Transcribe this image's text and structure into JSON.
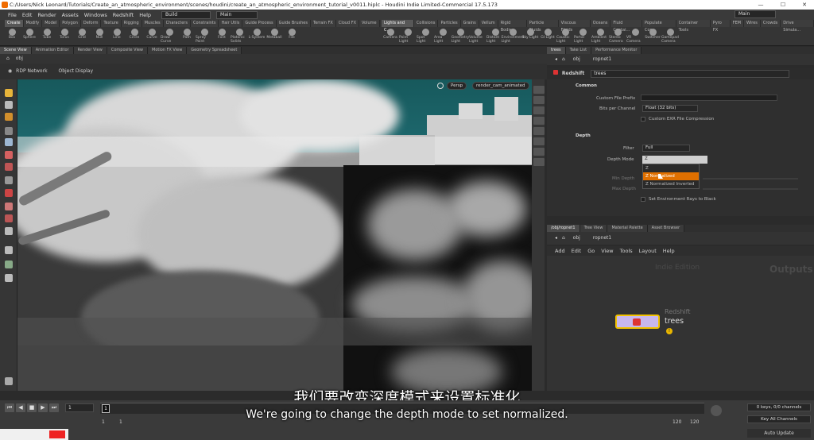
{
  "window": {
    "title": "C:/Users/Nick Leonard/Tutorials/Create_an_atmospheric_environment/scenes/houdini/create_an_atmospheric_environment_tutorial_v0011.hiplc - Houdini Indie Limited-Commercial 17.5.173",
    "minimize": "—",
    "maximize": "☐",
    "close": "✕"
  },
  "menu": {
    "items": [
      "File",
      "Edit",
      "Render",
      "Assets",
      "Windows",
      "Redshift",
      "Help"
    ],
    "desktop": "Build",
    "main": "Main",
    "right_desktop": "Main"
  },
  "shelf": {
    "tabs": [
      "Create",
      "Modify",
      "Model",
      "Polygon",
      "Deform",
      "Texture",
      "Rigging",
      "Muscles",
      "Characters",
      "Constraints",
      "Hair Utils",
      "Guide Process",
      "Guide Brushes",
      "Terrain FX",
      "Cloud FX",
      "Volume"
    ],
    "tools": [
      "Box",
      "Sphere",
      "Tube",
      "Torus",
      "Grid",
      "Null",
      "Line",
      "Circle",
      "Curve",
      "Draw Curve",
      "Path",
      "Spray Paint",
      "Font",
      "Platonic Solids",
      "L-System",
      "Metaball",
      "File"
    ],
    "tabs_right": [
      "Lights and C...",
      "Collisions",
      "Particles",
      "Grains",
      "Vellum",
      "Rigid Bodies",
      "Particle Fluids",
      "Viscous Fluids",
      "Oceans",
      "Fluid Contai...",
      "Populate Con...",
      "Container Tools",
      "Pyro FX",
      "FEM",
      "Wires",
      "Crowds",
      "Drive Simula..."
    ],
    "tools_right": [
      "Camera",
      "Point Light",
      "Spot Light",
      "Area Light",
      "Geometry Light",
      "Volume Light",
      "Distant Light",
      "Environment Light",
      "Sky Light",
      "GI Light",
      "Caustic Light",
      "Portal Light",
      "Ambient Light",
      "Stereo Camera",
      "VR Camera",
      "Switcher",
      "Gamepad Camera"
    ]
  },
  "scene_tabs": [
    "Scene View",
    "Animation Editor",
    "Render View",
    "Composite View",
    "Motion FX View",
    "Geometry Spreadsheet"
  ],
  "viewport": {
    "path": "obj",
    "render_label": "RDP Network",
    "display_label": "Object Display",
    "persp": "Persp",
    "camera": "render_cam_animated"
  },
  "right_tabs": [
    "trees",
    "Take List",
    "Performance Monitor"
  ],
  "params": {
    "path_obj": "obj",
    "path_node": "ropnet1",
    "node_type": "Redshift",
    "node_name": "trees",
    "section_common": "Common",
    "custom_file_prefix": "Custom File Prefix",
    "bits_per_channel": "Bits per Channel",
    "bits_value": "Float (32 bits)",
    "exr_compression": "Custom EXR File Compression",
    "section_depth": "Depth",
    "filter_label": "Filter",
    "filter_value": "Full",
    "depth_mode_label": "Depth Mode",
    "depth_mode_value": "Z",
    "dropdown_options": [
      "Z",
      "Z Normalized",
      "Z Normalized Inverted"
    ],
    "min_depth": "Min Depth",
    "max_depth": "Max Depth",
    "set_env_rays": "Set Environment Rays to Black"
  },
  "network": {
    "tabs": [
      "/obj/ropnet1",
      "Tree View",
      "Material Palette",
      "Asset Browser"
    ],
    "path_obj": "obj",
    "path_node": "ropnet1",
    "menu": [
      "Add",
      "Edit",
      "Go",
      "View",
      "Tools",
      "Layout",
      "Help"
    ],
    "watermark": "Indie Edition",
    "outputs": "Outputs",
    "node_type": "Redshift",
    "node_name": "trees"
  },
  "timeline": {
    "frame": "1",
    "start": "1",
    "start2": "1",
    "end": "120",
    "end2": "120",
    "keys": "0 keys, 0/0 channels",
    "key_all": "Key All Channels",
    "auto_update": "Auto Update"
  },
  "subtitles": {
    "zh": "我们要改变深度模式来设置标准化",
    "en": "We're going to change the depth mode to set normalized."
  },
  "colors": {
    "accent": "#e07000",
    "sky": "#1e6a70"
  }
}
